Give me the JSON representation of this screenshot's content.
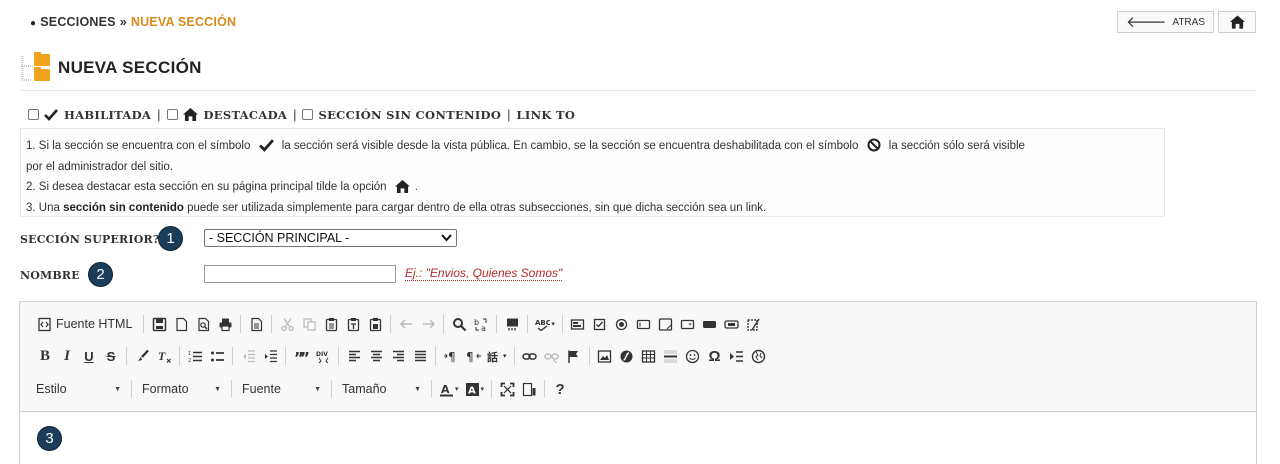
{
  "breadcrumb": {
    "root": "SECCIONES",
    "separator": "»",
    "current": "NUEVA SECCIÓN"
  },
  "top_buttons": {
    "back_label": "ATRAS"
  },
  "page": {
    "title": "NUEVA SECCIÓN"
  },
  "options": {
    "enabled_label": "HABILITADA",
    "featured_label": "DESTACADA",
    "no_content_label": "SECCIÓN SIN CONTENIDO",
    "link_to_label": "LINK TO",
    "pipe": "|"
  },
  "info": {
    "line1a": "1. Si la sección se encuentra con el símbolo",
    "line1b": "la sección será visible desde la vista pública. En cambio, se la sección se encuentra deshabilitada con el símbolo",
    "line1c": "la sección sólo será visible",
    "line2": "por el administrador del sitio.",
    "line3a": "2. Si desea destacar esta sección en su página principal tilde la opción",
    "line3b": ".",
    "line4a": "3. Una",
    "line4b": "sección sin contenido",
    "line4c": "puede ser utilizada simplemente para cargar dentro de ella otras subsecciones, sin que dicha sección sea un link."
  },
  "form": {
    "parent_label": "SECCIÓN SUPERIOR?",
    "parent_value": "- SECCIÓN PRINCIPAL -",
    "name_label": "NOMBRE",
    "name_value": "",
    "name_example": "Ej.: \"Envios, Quienes Somos\"",
    "step1": "1",
    "step2": "2",
    "step3": "3"
  },
  "editor": {
    "source_label": "Fuente HTML",
    "style_combo": "Estilo",
    "format_combo": "Formato",
    "font_combo": "Fuente",
    "size_combo": "Tamaño",
    "bold": "B",
    "italic": "I",
    "underline": "U",
    "strike": "S",
    "help": "?",
    "omega": "Ω"
  },
  "colors": {
    "accent": "#d88a1c",
    "badge": "#1c3d5a",
    "example": "#b3282d"
  }
}
